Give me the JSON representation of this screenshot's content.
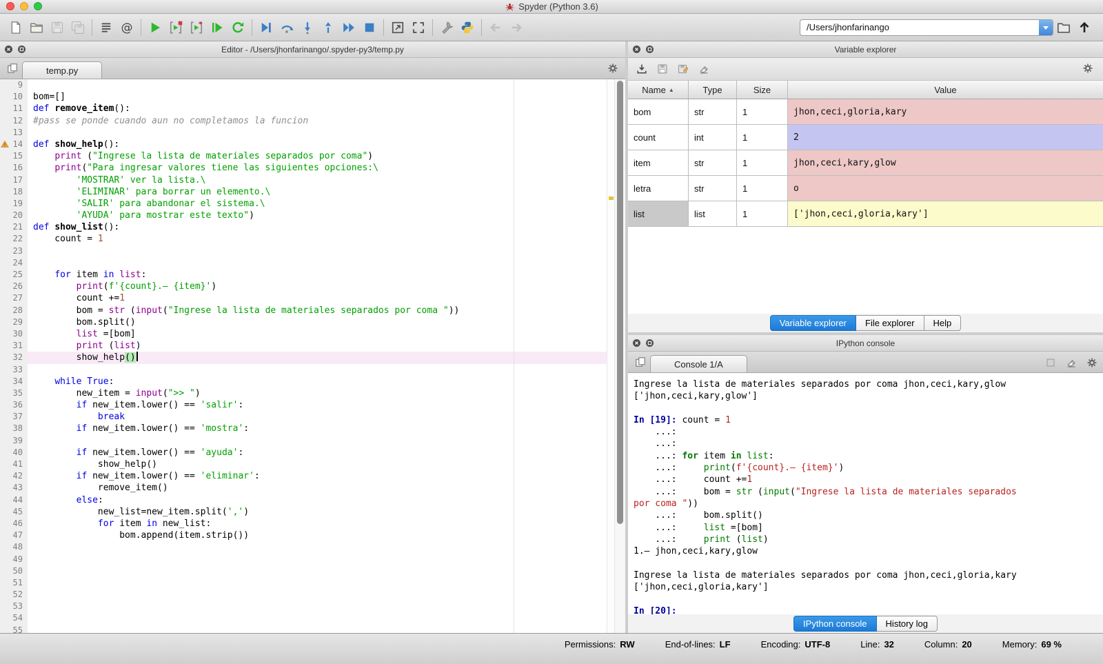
{
  "window": {
    "title": "Spyder (Python 3.6)"
  },
  "colors": {
    "accent_blue": "#1d7ad6",
    "str_value_bg": "#eec7c7",
    "int_value_bg": "#c5c5f2",
    "list_value_bg": "#fbfbcb",
    "current_line_bg": "#f8eaf6",
    "run_green": "#2eb82e",
    "debug_blue": "#3c7fc4"
  },
  "toolbar": {
    "path_value": "/Users/jhonfarinango",
    "buttons": [
      {
        "name": "new-file-button",
        "icon": "new-file-icon"
      },
      {
        "name": "open-file-button",
        "icon": "open-folder-icon"
      },
      {
        "name": "save-button",
        "icon": "save-icon",
        "disabled": true
      },
      {
        "name": "save-all-button",
        "icon": "save-all-icon",
        "disabled": true
      },
      {
        "sep": true
      },
      {
        "name": "file-switcher-button",
        "icon": "file-switcher-icon"
      },
      {
        "name": "symbol-finder-button",
        "icon": "at-icon"
      },
      {
        "sep": true
      },
      {
        "name": "run-button",
        "icon": "run-icon"
      },
      {
        "name": "run-cell-button",
        "icon": "run-cell-icon"
      },
      {
        "name": "run-cell-advance-button",
        "icon": "run-cell-advance-icon"
      },
      {
        "name": "run-selection-button",
        "icon": "run-selection-icon"
      },
      {
        "name": "rerun-cell-button",
        "icon": "rerun-icon"
      },
      {
        "sep": true
      },
      {
        "name": "debug-button",
        "icon": "debug-icon"
      },
      {
        "name": "step-over-button",
        "icon": "step-over-icon"
      },
      {
        "name": "step-into-button",
        "icon": "step-into-icon"
      },
      {
        "name": "step-out-button",
        "icon": "step-out-icon"
      },
      {
        "name": "debug-continue-button",
        "icon": "continue-icon"
      },
      {
        "name": "debug-stop-button",
        "icon": "stop-icon"
      },
      {
        "sep": true
      },
      {
        "name": "maximize-pane-button",
        "icon": "maximize-icon"
      },
      {
        "name": "fullscreen-button",
        "icon": "fullscreen-icon"
      },
      {
        "sep": true
      },
      {
        "name": "preferences-button",
        "icon": "wrench-icon"
      },
      {
        "name": "pythonpath-button",
        "icon": "python-icon"
      },
      {
        "sep": true
      },
      {
        "name": "back-button",
        "icon": "back-icon",
        "disabled": true
      },
      {
        "name": "forward-button",
        "icon": "forward-icon",
        "disabled": true
      }
    ]
  },
  "editor": {
    "header_title": "Editor - /Users/jhonfarinango/.spyder-py3/temp.py",
    "tab": "temp.py",
    "lines": [
      {
        "no": 9,
        "t": []
      },
      {
        "no": 10,
        "t": [
          [
            "n",
            "bom=[]"
          ]
        ]
      },
      {
        "no": 11,
        "t": [
          [
            "k",
            "def"
          ],
          [
            "n",
            " "
          ],
          [
            "d",
            "remove_item"
          ],
          [
            "n",
            "():"
          ]
        ]
      },
      {
        "no": 12,
        "t": [
          [
            "c",
            "#pass se ponde cuando aun no completamos la funcion"
          ]
        ]
      },
      {
        "no": 13,
        "t": []
      },
      {
        "no": 14,
        "warn": true,
        "t": [
          [
            "k",
            "def"
          ],
          [
            "n",
            " "
          ],
          [
            "d",
            "show_help"
          ],
          [
            "n",
            "():"
          ]
        ]
      },
      {
        "no": 15,
        "t": [
          [
            "n",
            "    "
          ],
          [
            "b",
            "print"
          ],
          [
            "n",
            " ("
          ],
          [
            "s",
            "\"Ingrese la lista de materiales separados por coma\""
          ],
          [
            "n",
            ")"
          ]
        ]
      },
      {
        "no": 16,
        "t": [
          [
            "n",
            "    "
          ],
          [
            "b",
            "print"
          ],
          [
            "n",
            "("
          ],
          [
            "s",
            "\"Para ingresar valores tiene las siguientes opciones:\\"
          ]
        ]
      },
      {
        "no": 17,
        "t": [
          [
            "s",
            "        'MOSTRAR' ver la lista.\\"
          ]
        ]
      },
      {
        "no": 18,
        "t": [
          [
            "s",
            "        'ELIMINAR' para borrar un elemento.\\"
          ]
        ]
      },
      {
        "no": 19,
        "t": [
          [
            "s",
            "        'SALIR' para abandonar el sistema.\\"
          ]
        ]
      },
      {
        "no": 20,
        "t": [
          [
            "s",
            "        'AYUDA' para mostrar este texto\""
          ],
          [
            "n",
            ")"
          ]
        ]
      },
      {
        "no": 21,
        "t": [
          [
            "k",
            "def"
          ],
          [
            "n",
            " "
          ],
          [
            "d",
            "show_list"
          ],
          [
            "n",
            "():"
          ]
        ]
      },
      {
        "no": 22,
        "t": [
          [
            "n",
            "    count = "
          ],
          [
            "m",
            "1"
          ]
        ]
      },
      {
        "no": 23,
        "t": []
      },
      {
        "no": 24,
        "t": []
      },
      {
        "no": 25,
        "t": [
          [
            "n",
            "    "
          ],
          [
            "k",
            "for"
          ],
          [
            "n",
            " item "
          ],
          [
            "k",
            "in"
          ],
          [
            "n",
            " "
          ],
          [
            "b",
            "list"
          ],
          [
            "n",
            ":"
          ]
        ]
      },
      {
        "no": 26,
        "t": [
          [
            "n",
            "        "
          ],
          [
            "b",
            "print"
          ],
          [
            "n",
            "("
          ],
          [
            "s",
            "f'{count}.– {item}'"
          ],
          [
            "n",
            ")"
          ]
        ]
      },
      {
        "no": 27,
        "t": [
          [
            "n",
            "        count +="
          ],
          [
            "m",
            "1"
          ]
        ]
      },
      {
        "no": 28,
        "t": [
          [
            "n",
            "        bom = "
          ],
          [
            "b",
            "str"
          ],
          [
            "n",
            " ("
          ],
          [
            "b",
            "input"
          ],
          [
            "n",
            "("
          ],
          [
            "s",
            "\"Ingrese la lista de materiales separados por coma \""
          ],
          [
            "n",
            "))"
          ]
        ]
      },
      {
        "no": 29,
        "t": [
          [
            "n",
            "        bom.split()"
          ]
        ]
      },
      {
        "no": 30,
        "t": [
          [
            "n",
            "        "
          ],
          [
            "b",
            "list"
          ],
          [
            "n",
            " =[bom]"
          ]
        ]
      },
      {
        "no": 31,
        "t": [
          [
            "n",
            "        "
          ],
          [
            "b",
            "print"
          ],
          [
            "n",
            " ("
          ],
          [
            "b",
            "list"
          ],
          [
            "n",
            ")"
          ]
        ]
      },
      {
        "no": 32,
        "current": true,
        "cursor": true,
        "t": [
          [
            "n",
            "        show_help"
          ],
          [
            "p",
            "()"
          ]
        ]
      },
      {
        "no": 33,
        "t": []
      },
      {
        "no": 34,
        "t": [
          [
            "n",
            "    "
          ],
          [
            "k",
            "while"
          ],
          [
            "n",
            " "
          ],
          [
            "k",
            "True"
          ],
          [
            "n",
            ":"
          ]
        ]
      },
      {
        "no": 35,
        "t": [
          [
            "n",
            "        new_item = "
          ],
          [
            "b",
            "input"
          ],
          [
            "n",
            "("
          ],
          [
            "s",
            "\">> \""
          ],
          [
            "n",
            ")"
          ]
        ]
      },
      {
        "no": 36,
        "t": [
          [
            "n",
            "        "
          ],
          [
            "k",
            "if"
          ],
          [
            "n",
            " new_item.lower() == "
          ],
          [
            "s",
            "'salir'"
          ],
          [
            "n",
            ":"
          ]
        ]
      },
      {
        "no": 37,
        "t": [
          [
            "n",
            "            "
          ],
          [
            "k",
            "break"
          ]
        ]
      },
      {
        "no": 38,
        "t": [
          [
            "n",
            "        "
          ],
          [
            "k",
            "if"
          ],
          [
            "n",
            " new_item.lower() == "
          ],
          [
            "s",
            "'mostra'"
          ],
          [
            "n",
            ":"
          ]
        ]
      },
      {
        "no": 39,
        "t": []
      },
      {
        "no": 40,
        "t": [
          [
            "n",
            "        "
          ],
          [
            "k",
            "if"
          ],
          [
            "n",
            " new_item.lower() == "
          ],
          [
            "s",
            "'ayuda'"
          ],
          [
            "n",
            ":"
          ]
        ]
      },
      {
        "no": 41,
        "t": [
          [
            "n",
            "            show_help()"
          ]
        ]
      },
      {
        "no": 42,
        "t": [
          [
            "n",
            "        "
          ],
          [
            "k",
            "if"
          ],
          [
            "n",
            " new_item.lower() == "
          ],
          [
            "s",
            "'eliminar'"
          ],
          [
            "n",
            ":"
          ]
        ]
      },
      {
        "no": 43,
        "t": [
          [
            "n",
            "            remove_item()"
          ]
        ]
      },
      {
        "no": 44,
        "t": [
          [
            "n",
            "        "
          ],
          [
            "k",
            "else"
          ],
          [
            "n",
            ":"
          ]
        ]
      },
      {
        "no": 45,
        "t": [
          [
            "n",
            "            new_list=new_item.split("
          ],
          [
            "s",
            "','"
          ],
          [
            "n",
            ")"
          ]
        ]
      },
      {
        "no": 46,
        "t": [
          [
            "n",
            "            "
          ],
          [
            "k",
            "for"
          ],
          [
            "n",
            " item "
          ],
          [
            "k",
            "in"
          ],
          [
            "n",
            " new_list:"
          ]
        ]
      },
      {
        "no": 47,
        "t": [
          [
            "n",
            "                bom.append(item.strip())"
          ]
        ]
      },
      {
        "no": 48,
        "t": []
      },
      {
        "no": 49,
        "t": []
      },
      {
        "no": 50,
        "t": []
      },
      {
        "no": 51,
        "t": []
      },
      {
        "no": 52,
        "t": []
      },
      {
        "no": 53,
        "t": []
      },
      {
        "no": 54,
        "t": []
      },
      {
        "no": 55,
        "t": []
      }
    ]
  },
  "variable_explorer": {
    "title": "Variable explorer",
    "columns": [
      "Name",
      "Type",
      "Size",
      "Value"
    ],
    "sort": {
      "column": "Name",
      "glyph": "▲"
    },
    "toolbar_buttons": [
      {
        "name": "import-data-button",
        "icon": "import-icon"
      },
      {
        "name": "save-data-button",
        "icon": "save-icon"
      },
      {
        "name": "save-data-as-button",
        "icon": "save-as-icon"
      },
      {
        "name": "reset-namespace-button",
        "icon": "eraser-icon"
      }
    ],
    "rows": [
      {
        "name": "bom",
        "type": "str",
        "size": "1",
        "value": "jhon,ceci,gloria,kary",
        "value_bg": "#eec7c7"
      },
      {
        "name": "count",
        "type": "int",
        "size": "1",
        "value": "2",
        "value_bg": "#c5c5f2"
      },
      {
        "name": "item",
        "type": "str",
        "size": "1",
        "value": "jhon,ceci,kary,glow",
        "value_bg": "#eec7c7"
      },
      {
        "name": "letra",
        "type": "str",
        "size": "1",
        "value": "o",
        "value_bg": "#eec7c7"
      },
      {
        "name": "list",
        "type": "list",
        "size": "1",
        "value": "['jhon,ceci,gloria,kary']",
        "value_bg": "#fbfbcb",
        "selected": true
      }
    ],
    "tabs": [
      {
        "label": "Variable explorer",
        "active": true
      },
      {
        "label": "File explorer"
      },
      {
        "label": "Help"
      }
    ]
  },
  "console": {
    "title": "IPython console",
    "tab": "Console 1/A",
    "toolbar_buttons": [
      {
        "name": "inspect-button",
        "icon": "square-icon"
      },
      {
        "name": "clear-console-button",
        "icon": "eraser-icon"
      },
      {
        "name": "console-options-button",
        "icon": "gear-icon"
      }
    ],
    "lines": [
      {
        "t": [
          [
            "t",
            "Ingrese la lista de materiales separados por coma jhon,ceci,kary,glow"
          ]
        ]
      },
      {
        "t": [
          [
            "t",
            "['jhon,ceci,kary,glow']"
          ]
        ]
      },
      {
        "t": []
      },
      {
        "t": [
          [
            "P",
            "In [19]: "
          ],
          [
            "t",
            "count = "
          ],
          [
            "m",
            "1"
          ]
        ]
      },
      {
        "t": [
          [
            "t",
            "    ...: "
          ]
        ]
      },
      {
        "t": [
          [
            "t",
            "    ...: "
          ]
        ]
      },
      {
        "t": [
          [
            "t",
            "    ...: "
          ],
          [
            "k",
            "for"
          ],
          [
            "t",
            " item "
          ],
          [
            "k",
            "in"
          ],
          [
            "t",
            " "
          ],
          [
            "b",
            "list"
          ],
          [
            "t",
            ":"
          ]
        ]
      },
      {
        "t": [
          [
            "t",
            "    ...:     "
          ],
          [
            "b",
            "print"
          ],
          [
            "t",
            "("
          ],
          [
            "s",
            "f'{count}.– {item}'"
          ],
          [
            "t",
            ")"
          ]
        ]
      },
      {
        "t": [
          [
            "t",
            "    ...:     count +="
          ],
          [
            "m",
            "1"
          ]
        ]
      },
      {
        "t": [
          [
            "t",
            "    ...:     bom = "
          ],
          [
            "b",
            "str"
          ],
          [
            "t",
            " ("
          ],
          [
            "b",
            "input"
          ],
          [
            "t",
            "("
          ],
          [
            "s",
            "\"Ingrese la lista de materiales separados"
          ]
        ]
      },
      {
        "t": [
          [
            "s",
            "por coma \""
          ],
          [
            "t",
            "))"
          ]
        ]
      },
      {
        "t": [
          [
            "t",
            "    ...:     bom.split()"
          ]
        ]
      },
      {
        "t": [
          [
            "t",
            "    ...:     "
          ],
          [
            "b",
            "list"
          ],
          [
            "t",
            " =[bom]"
          ]
        ]
      },
      {
        "t": [
          [
            "t",
            "    ...:     "
          ],
          [
            "b",
            "print"
          ],
          [
            "t",
            " ("
          ],
          [
            "b",
            "list"
          ],
          [
            "t",
            ")"
          ]
        ]
      },
      {
        "t": [
          [
            "t",
            "1.– jhon,ceci,kary,glow"
          ]
        ]
      },
      {
        "t": []
      },
      {
        "t": [
          [
            "t",
            "Ingrese la lista de materiales separados por coma jhon,ceci,gloria,kary"
          ]
        ]
      },
      {
        "t": [
          [
            "t",
            "['jhon,ceci,gloria,kary']"
          ]
        ]
      },
      {
        "t": []
      },
      {
        "t": [
          [
            "P",
            "In [20]: "
          ]
        ]
      }
    ],
    "tabs": [
      {
        "label": "IPython console",
        "active": true
      },
      {
        "label": "History log"
      }
    ]
  },
  "statusbar": {
    "items": [
      {
        "label": "Permissions:",
        "value": "RW"
      },
      {
        "label": "End-of-lines:",
        "value": "LF"
      },
      {
        "label": "Encoding:",
        "value": "UTF-8"
      },
      {
        "label": "Line:",
        "value": "32"
      },
      {
        "label": "Column:",
        "value": "20"
      },
      {
        "label": "Memory:",
        "value": "69 %"
      }
    ]
  }
}
